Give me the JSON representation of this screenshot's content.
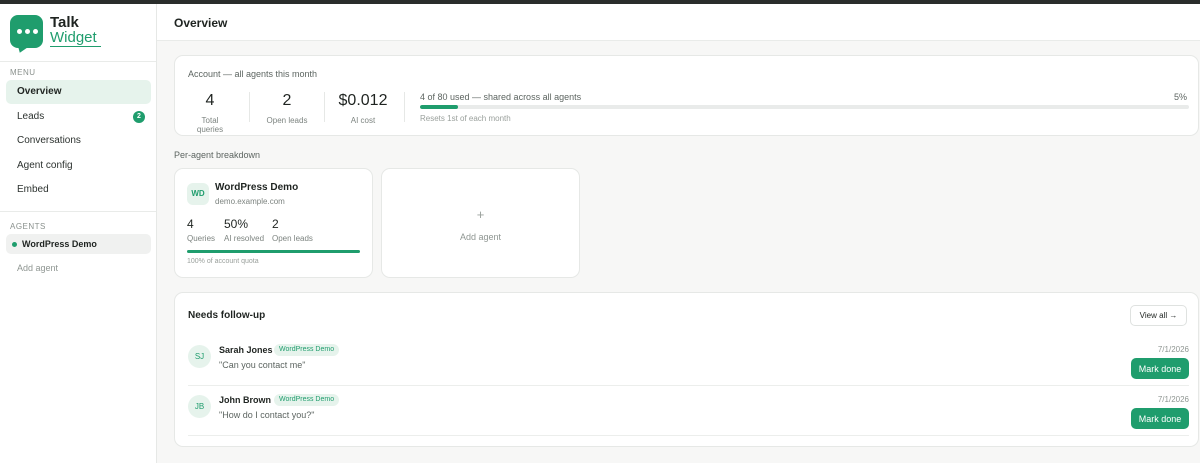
{
  "brand": {
    "line1": "Talk",
    "line2": "Widget"
  },
  "sidebar": {
    "menu_label": "MENU",
    "menu": [
      {
        "label": "Overview",
        "active": true
      },
      {
        "label": "Leads",
        "badge": "2"
      },
      {
        "label": "Conversations"
      },
      {
        "label": "Agent config"
      },
      {
        "label": "Embed"
      }
    ],
    "agents_label": "AGENTS",
    "agents": [
      {
        "label": "WordPress Demo"
      }
    ],
    "add_agent": "Add agent"
  },
  "header": {
    "title": "Overview"
  },
  "account": {
    "title": "Account — all agents this month",
    "stats": [
      {
        "value": "4",
        "label": "Total queries"
      },
      {
        "value": "2",
        "label": "Open leads"
      },
      {
        "value": "$0.012",
        "label": "AI cost"
      }
    ],
    "usage_text": "4 of 80 used — shared across all agents",
    "usage_percent": "5%",
    "usage_fraction": 0.05,
    "reset_text": "Resets 1st of each month"
  },
  "breakdown": {
    "heading": "Per-agent breakdown",
    "agent": {
      "initials": "WD",
      "name": "WordPress Demo",
      "domain": "demo.example.com",
      "stats": [
        {
          "value": "4",
          "label": "Queries"
        },
        {
          "value": "50%",
          "label": "AI resolved"
        },
        {
          "value": "2",
          "label": "Open leads"
        }
      ],
      "quota_fraction": 1.0,
      "quota_text": "100% of account quota"
    },
    "add_plus": "+",
    "add_label": "Add agent"
  },
  "followup": {
    "title": "Needs follow-up",
    "view_all": "View all →",
    "leads": [
      {
        "initials": "SJ",
        "name": "Sarah Jones",
        "tag": "WordPress Demo",
        "message": "\"Can you contact me\"",
        "date": "7/1/2026",
        "action": "Mark done"
      },
      {
        "initials": "JB",
        "name": "John Brown",
        "tag": "WordPress Demo",
        "message": "\"How do I contact you?\"",
        "date": "7/1/2026",
        "action": "Mark done"
      }
    ]
  },
  "colors": {
    "accent": "#1f9d6d",
    "accent_light": "#e6f3ec",
    "background": "#f7f7f6"
  }
}
